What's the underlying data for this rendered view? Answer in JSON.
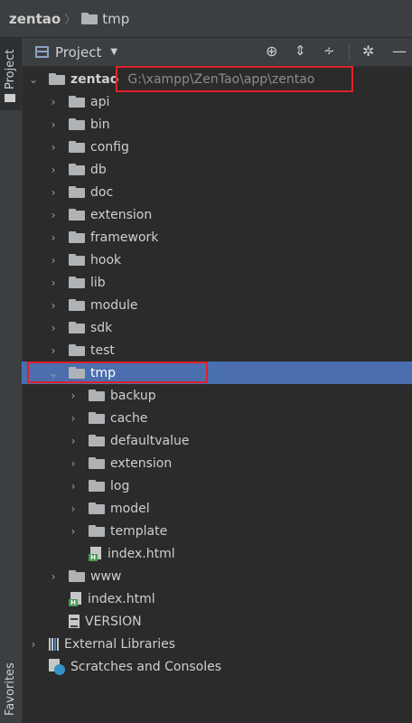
{
  "breadcrumb": {
    "project": "zentao",
    "folder": "tmp"
  },
  "side_strip": {
    "project_tab": "Project",
    "favorites_tab": "Favorites"
  },
  "toolbar": {
    "view_label": "Project",
    "icons": [
      "locate-icon",
      "expand-all-icon",
      "collapse-all-icon",
      "gear-icon",
      "minimize-icon"
    ]
  },
  "tree": {
    "root": {
      "label": "zentao",
      "path": "G:\\xampp\\ZenTao\\app\\zentao"
    },
    "rows": [
      {
        "label": "api",
        "type": "folder",
        "level": 1,
        "expanded": false
      },
      {
        "label": "bin",
        "type": "folder",
        "level": 1,
        "expanded": false
      },
      {
        "label": "config",
        "type": "folder",
        "level": 1,
        "expanded": false
      },
      {
        "label": "db",
        "type": "folder",
        "level": 1,
        "expanded": false
      },
      {
        "label": "doc",
        "type": "folder",
        "level": 1,
        "expanded": false
      },
      {
        "label": "extension",
        "type": "folder",
        "level": 1,
        "expanded": false
      },
      {
        "label": "framework",
        "type": "folder",
        "level": 1,
        "expanded": false
      },
      {
        "label": "hook",
        "type": "folder",
        "level": 1,
        "expanded": false
      },
      {
        "label": "lib",
        "type": "folder",
        "level": 1,
        "expanded": false
      },
      {
        "label": "module",
        "type": "folder",
        "level": 1,
        "expanded": false
      },
      {
        "label": "sdk",
        "type": "folder",
        "level": 1,
        "expanded": false
      },
      {
        "label": "test",
        "type": "folder",
        "level": 1,
        "expanded": false
      },
      {
        "label": "tmp",
        "type": "folder",
        "level": 1,
        "expanded": true,
        "selected": true
      },
      {
        "label": "backup",
        "type": "folder",
        "level": 2,
        "expanded": false
      },
      {
        "label": "cache",
        "type": "folder",
        "level": 2,
        "expanded": false
      },
      {
        "label": "defaultvalue",
        "type": "folder",
        "level": 2,
        "expanded": false
      },
      {
        "label": "extension",
        "type": "folder",
        "level": 2,
        "expanded": false
      },
      {
        "label": "log",
        "type": "folder",
        "level": 2,
        "expanded": false
      },
      {
        "label": "model",
        "type": "folder",
        "level": 2,
        "expanded": false
      },
      {
        "label": "template",
        "type": "folder",
        "level": 2,
        "expanded": false
      },
      {
        "label": "index.html",
        "type": "html",
        "level": 2
      },
      {
        "label": "www",
        "type": "folder",
        "level": 1,
        "expanded": false
      },
      {
        "label": "index.html",
        "type": "html",
        "level": 1
      },
      {
        "label": "VERSION",
        "type": "text",
        "level": 1
      },
      {
        "label": "External Libraries",
        "type": "libraries",
        "level": 0,
        "expanded": false
      },
      {
        "label": "Scratches and Consoles",
        "type": "scratches",
        "level": 0
      }
    ]
  },
  "colors": {
    "selection": "#4b6eaf",
    "highlight_box": "#e0202a",
    "panel_bg": "#2b2b2b"
  }
}
